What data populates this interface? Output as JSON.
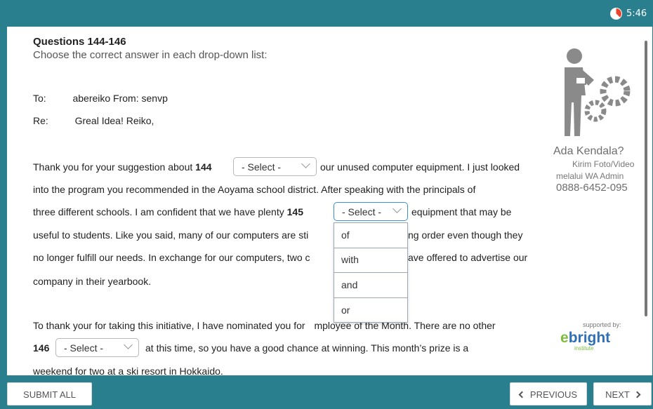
{
  "header": {
    "timer": "5:46",
    "timer_icon": "clock-icon"
  },
  "question": {
    "title": "Questions 144-146",
    "instruction": "Choose the correct answer in each drop-down list:"
  },
  "email": {
    "to_label": "To:",
    "to_value": "abereiko From: senvp",
    "re_label": "Re:",
    "re_value": "Greal Idea! Reiko,",
    "p1_l1_a": "Thank you for your suggestion about",
    "p1_l1_num": "144",
    "p1_l1_b": "our unused computer equipment. I just looked",
    "p1_l2": "into the program you recommended in the Aoyama school district. After speaking with the principals of",
    "p1_l3_a": "three different schools. I am confident that we have plenty",
    "p1_l3_num": "145",
    "p1_l3_b": "equipment that may be",
    "p1_l4_a": "useful to students. Like you said, many of our computers are sti",
    "p1_l4_b": "ng order even though they",
    "p1_l5_a": "no longer fulfill our needs. In exchange for our computers, two c",
    "p1_l5_b": "ave offered to advertise our",
    "p1_l6": "company in their yearbook.",
    "p2_l1_a": "To thank your for taking this initiative, I have nominated you for ",
    "p2_l1_b": "mployee of the Month. There are no other",
    "p2_l2_num": "146",
    "p2_l2_b": "at this time, so you have a good chance at winning. This month’s prize is a",
    "p2_l3": "weekend for two at a ski resort in Hokkaido."
  },
  "selects": {
    "s144": "- Select -",
    "s145": "- Select -",
    "s146": "- Select -"
  },
  "dropdown_options": [
    "of",
    "with",
    "and",
    "or"
  ],
  "ad": {
    "title": "Ada Kendala?",
    "line2": "Kirim Foto/Video",
    "line3": "melalui WA Admin",
    "phone": "0888-6452-095"
  },
  "sponsor": {
    "supported_by": "supported by:",
    "logo_e": "e",
    "logo_rest": "bright",
    "logo_sub": "institute"
  },
  "footer": {
    "submit_all": "SUBMIT ALL",
    "previous": "PREVIOUS",
    "next": "NEXT"
  }
}
